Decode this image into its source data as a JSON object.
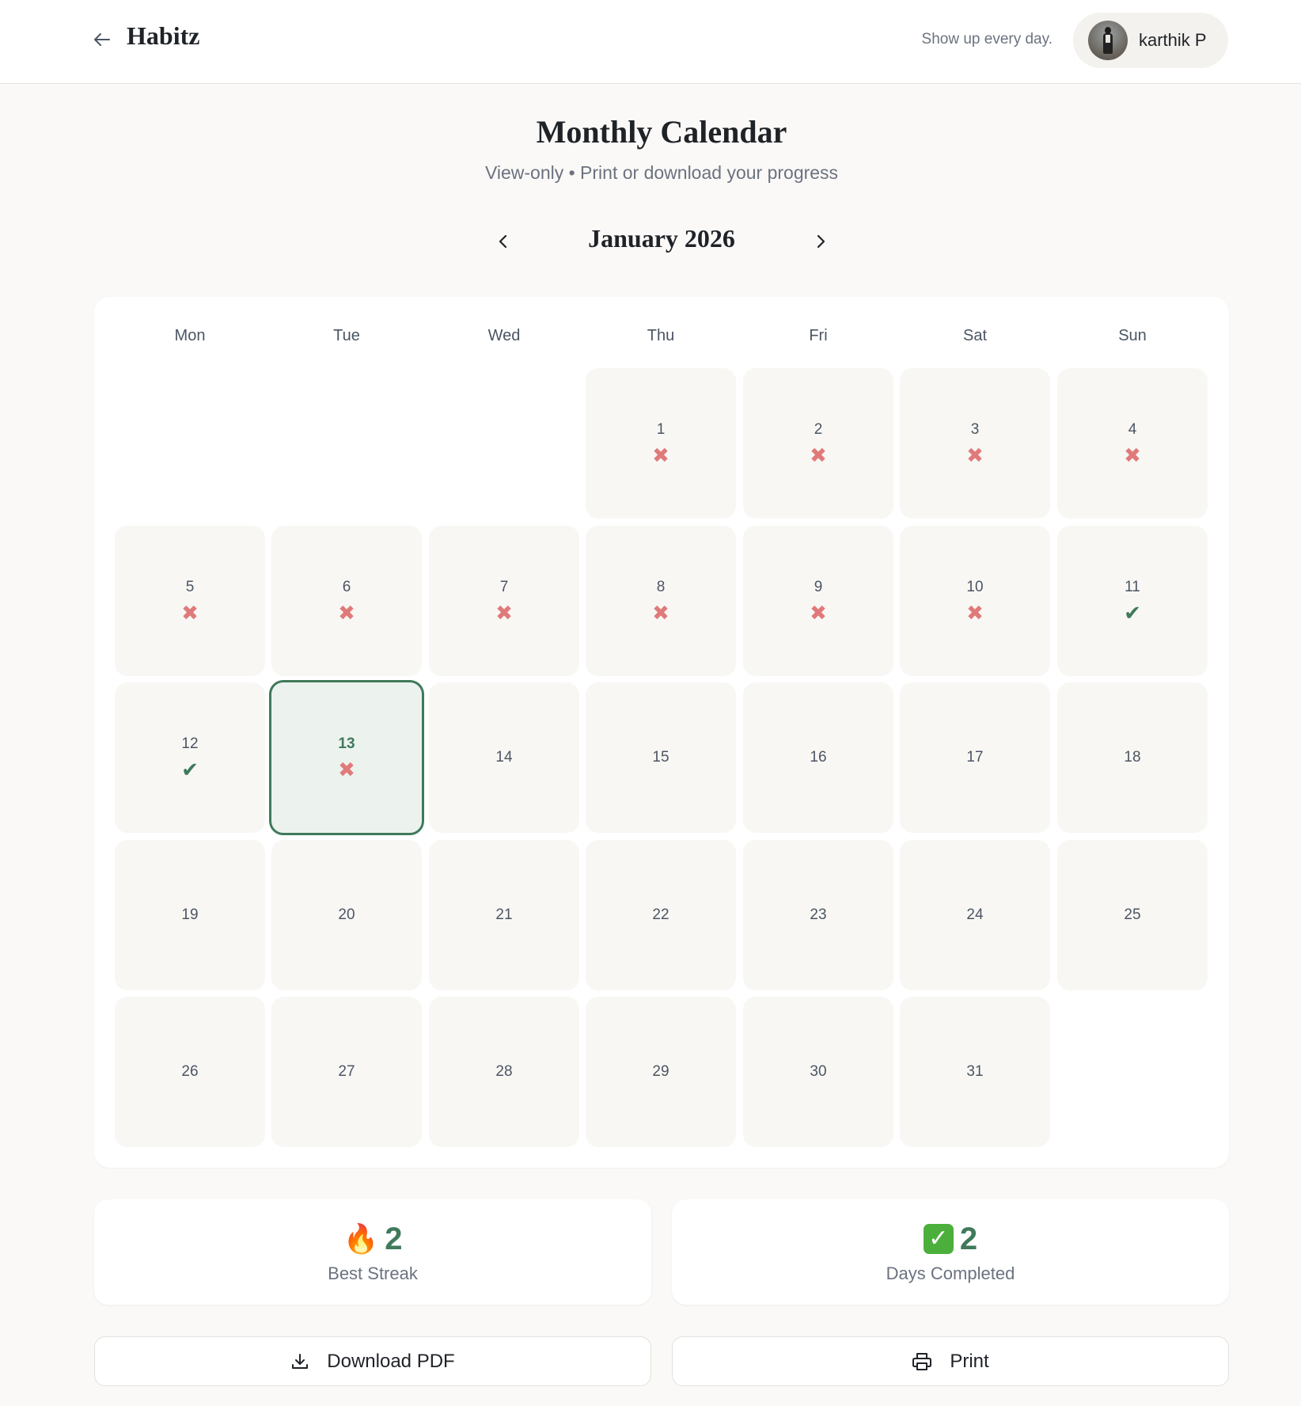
{
  "header": {
    "brand": "Habitz",
    "tagline": "Show up every day.",
    "user_name": "karthik P"
  },
  "page": {
    "title": "Monthly Calendar",
    "subtitle": "View-only • Print or download your progress"
  },
  "month_nav": {
    "label": "January 2026"
  },
  "weekdays": [
    "Mon",
    "Tue",
    "Wed",
    "Thu",
    "Fri",
    "Sat",
    "Sun"
  ],
  "calendar": {
    "first_weekday_index": 3,
    "today": 13,
    "days": [
      {
        "n": "1",
        "status": "missed"
      },
      {
        "n": "2",
        "status": "missed"
      },
      {
        "n": "3",
        "status": "missed"
      },
      {
        "n": "4",
        "status": "missed"
      },
      {
        "n": "5",
        "status": "missed"
      },
      {
        "n": "6",
        "status": "missed"
      },
      {
        "n": "7",
        "status": "missed"
      },
      {
        "n": "8",
        "status": "missed"
      },
      {
        "n": "9",
        "status": "missed"
      },
      {
        "n": "10",
        "status": "missed"
      },
      {
        "n": "11",
        "status": "done"
      },
      {
        "n": "12",
        "status": "done"
      },
      {
        "n": "13",
        "status": "missed"
      },
      {
        "n": "14",
        "status": "none"
      },
      {
        "n": "15",
        "status": "none"
      },
      {
        "n": "16",
        "status": "none"
      },
      {
        "n": "17",
        "status": "none"
      },
      {
        "n": "18",
        "status": "none"
      },
      {
        "n": "19",
        "status": "none"
      },
      {
        "n": "20",
        "status": "none"
      },
      {
        "n": "21",
        "status": "none"
      },
      {
        "n": "22",
        "status": "none"
      },
      {
        "n": "23",
        "status": "none"
      },
      {
        "n": "24",
        "status": "none"
      },
      {
        "n": "25",
        "status": "none"
      },
      {
        "n": "26",
        "status": "none"
      },
      {
        "n": "27",
        "status": "none"
      },
      {
        "n": "28",
        "status": "none"
      },
      {
        "n": "29",
        "status": "none"
      },
      {
        "n": "30",
        "status": "none"
      },
      {
        "n": "31",
        "status": "none"
      }
    ]
  },
  "stats": {
    "best_streak": {
      "icon": "fire-icon",
      "value": "2",
      "label": "Best Streak"
    },
    "days_completed": {
      "icon": "check-box-icon",
      "value": "2",
      "label": "Days Completed"
    }
  },
  "actions": {
    "download_label": "Download PDF",
    "print_label": "Print"
  },
  "colors": {
    "accent": "#3f7a5a",
    "missed": "#e07a7a",
    "background": "#faf9f7"
  }
}
